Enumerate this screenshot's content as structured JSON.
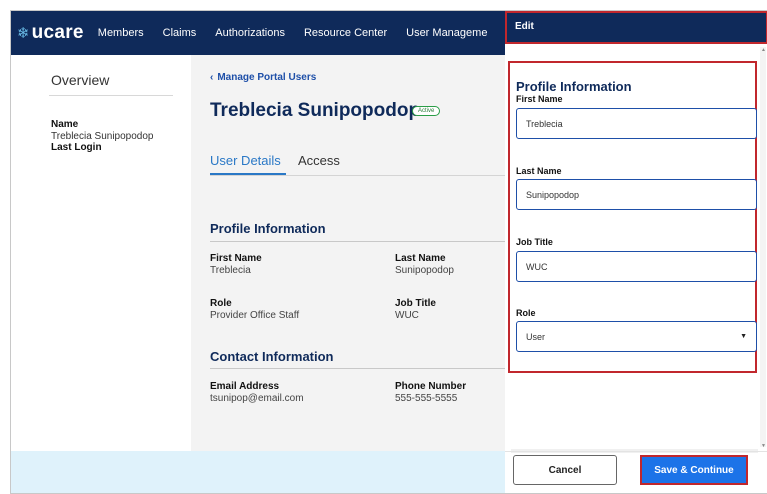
{
  "nav": {
    "logo": "ucare",
    "items": [
      "Members",
      "Claims",
      "Authorizations",
      "Resource Center",
      "User Manageme"
    ]
  },
  "left": {
    "overview": "Overview",
    "name_label": "Name",
    "name_value": "Treblecia Sunipopodop",
    "last_login_label": "Last Login"
  },
  "main": {
    "back_link": "Manage Portal Users",
    "user_name": "Treblecia Sunipopodop",
    "status_badge": "Active",
    "tabs": [
      "User Details",
      "Access"
    ],
    "profile": {
      "title": "Profile Information",
      "first_name_label": "First Name",
      "first_name": "Treblecia",
      "last_name_label": "Last Name",
      "last_name": "Sunipopodop",
      "role_label": "Role",
      "role": "Provider Office Staff",
      "job_title_label": "Job Title",
      "job_title": "WUC"
    },
    "contact": {
      "title": "Contact Information",
      "email_label": "Email Address",
      "email": "tsunipop@email.com",
      "phone_label": "Phone Number",
      "phone": "555-555-5555"
    }
  },
  "edit": {
    "header": "Edit",
    "section_title": "Profile Information",
    "first_name_label": "First Name",
    "first_name_value": "Treblecia",
    "last_name_label": "Last Name",
    "last_name_value": "Sunipopodop",
    "job_title_label": "Job Title",
    "job_title_value": "WUC",
    "role_label": "Role",
    "role_value": "User",
    "cancel": "Cancel",
    "save": "Save & Continue"
  },
  "colors": {
    "navy": "#0f2a5a",
    "accent_blue": "#1c73e8",
    "highlight_red": "#c1272d",
    "active_green": "#2a9d46",
    "footer_tint": "#dff2fb"
  }
}
